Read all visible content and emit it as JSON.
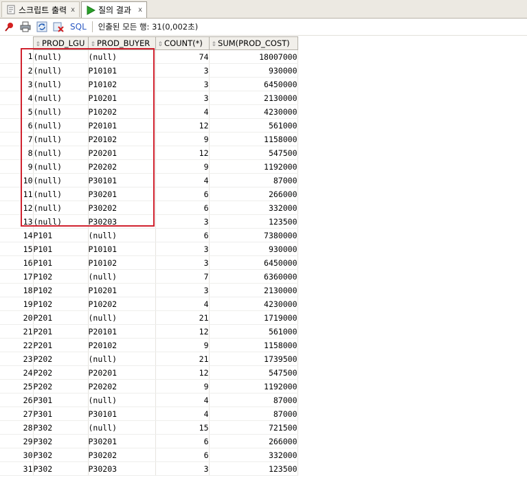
{
  "tabs": [
    {
      "label": "스크립트 출력",
      "close": "x"
    },
    {
      "label": "질의 결과",
      "close": "x"
    }
  ],
  "toolbar": {
    "sql_label": "SQL",
    "status": "인출된 모든 행: 31(0,002초)"
  },
  "columns": [
    "PROD_LGU",
    "PROD_BUYER",
    "COUNT(*)",
    "SUM(PROD_COST)"
  ],
  "rows": [
    {
      "n": "1",
      "lgu": "(null)",
      "buyer": "(null)",
      "count": "74",
      "sum": "18007000"
    },
    {
      "n": "2",
      "lgu": "(null)",
      "buyer": "P10101",
      "count": "3",
      "sum": "930000"
    },
    {
      "n": "3",
      "lgu": "(null)",
      "buyer": "P10102",
      "count": "3",
      "sum": "6450000"
    },
    {
      "n": "4",
      "lgu": "(null)",
      "buyer": "P10201",
      "count": "3",
      "sum": "2130000"
    },
    {
      "n": "5",
      "lgu": "(null)",
      "buyer": "P10202",
      "count": "4",
      "sum": "4230000"
    },
    {
      "n": "6",
      "lgu": "(null)",
      "buyer": "P20101",
      "count": "12",
      "sum": "561000"
    },
    {
      "n": "7",
      "lgu": "(null)",
      "buyer": "P20102",
      "count": "9",
      "sum": "1158000"
    },
    {
      "n": "8",
      "lgu": "(null)",
      "buyer": "P20201",
      "count": "12",
      "sum": "547500"
    },
    {
      "n": "9",
      "lgu": "(null)",
      "buyer": "P20202",
      "count": "9",
      "sum": "1192000"
    },
    {
      "n": "10",
      "lgu": "(null)",
      "buyer": "P30101",
      "count": "4",
      "sum": "87000"
    },
    {
      "n": "11",
      "lgu": "(null)",
      "buyer": "P30201",
      "count": "6",
      "sum": "266000"
    },
    {
      "n": "12",
      "lgu": "(null)",
      "buyer": "P30202",
      "count": "6",
      "sum": "332000"
    },
    {
      "n": "13",
      "lgu": "(null)",
      "buyer": "P30203",
      "count": "3",
      "sum": "123500"
    },
    {
      "n": "14",
      "lgu": "P101",
      "buyer": "(null)",
      "count": "6",
      "sum": "7380000"
    },
    {
      "n": "15",
      "lgu": "P101",
      "buyer": "P10101",
      "count": "3",
      "sum": "930000"
    },
    {
      "n": "16",
      "lgu": "P101",
      "buyer": "P10102",
      "count": "3",
      "sum": "6450000"
    },
    {
      "n": "17",
      "lgu": "P102",
      "buyer": "(null)",
      "count": "7",
      "sum": "6360000"
    },
    {
      "n": "18",
      "lgu": "P102",
      "buyer": "P10201",
      "count": "3",
      "sum": "2130000"
    },
    {
      "n": "19",
      "lgu": "P102",
      "buyer": "P10202",
      "count": "4",
      "sum": "4230000"
    },
    {
      "n": "20",
      "lgu": "P201",
      "buyer": "(null)",
      "count": "21",
      "sum": "1719000"
    },
    {
      "n": "21",
      "lgu": "P201",
      "buyer": "P20101",
      "count": "12",
      "sum": "561000"
    },
    {
      "n": "22",
      "lgu": "P201",
      "buyer": "P20102",
      "count": "9",
      "sum": "1158000"
    },
    {
      "n": "23",
      "lgu": "P202",
      "buyer": "(null)",
      "count": "21",
      "sum": "1739500"
    },
    {
      "n": "24",
      "lgu": "P202",
      "buyer": "P20201",
      "count": "12",
      "sum": "547500"
    },
    {
      "n": "25",
      "lgu": "P202",
      "buyer": "P20202",
      "count": "9",
      "sum": "1192000"
    },
    {
      "n": "26",
      "lgu": "P301",
      "buyer": "(null)",
      "count": "4",
      "sum": "87000"
    },
    {
      "n": "27",
      "lgu": "P301",
      "buyer": "P30101",
      "count": "4",
      "sum": "87000"
    },
    {
      "n": "28",
      "lgu": "P302",
      "buyer": "(null)",
      "count": "15",
      "sum": "721500"
    },
    {
      "n": "29",
      "lgu": "P302",
      "buyer": "P30201",
      "count": "6",
      "sum": "266000"
    },
    {
      "n": "30",
      "lgu": "P302",
      "buyer": "P30202",
      "count": "6",
      "sum": "332000"
    },
    {
      "n": "31",
      "lgu": "P302",
      "buyer": "P30203",
      "count": "3",
      "sum": "123500"
    }
  ],
  "colors": {
    "highlight": "#d0202d",
    "run_icon": "#2aa12a",
    "sql_link": "#2b59c3"
  },
  "icons": [
    "script-icon",
    "run-icon",
    "pin-icon",
    "print-icon",
    "refresh-icon",
    "clear-icon",
    "sort-icon"
  ]
}
